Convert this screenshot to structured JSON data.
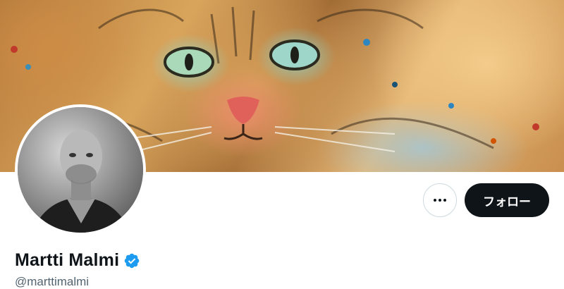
{
  "profile": {
    "display_name": "Martti Malmi",
    "handle": "@marttimalmi",
    "verified": true,
    "verified_icon": "verified-badge-icon",
    "banner_description_icon": "cat-artwork-banner",
    "avatar_icon": "profile-photo"
  },
  "actions": {
    "more_icon": "more-options-icon",
    "follow_label": "フォロー"
  },
  "colors": {
    "follow_bg": "#0f1419",
    "follow_text": "#ffffff",
    "verified": "#1d9bf0",
    "name": "#0f1419",
    "handle": "#536471",
    "border": "#cfd9de"
  }
}
